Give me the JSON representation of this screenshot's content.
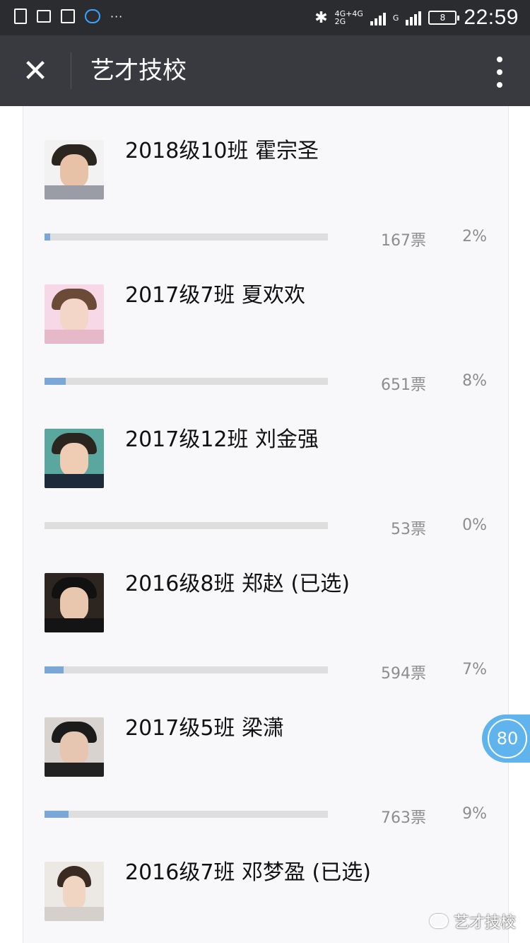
{
  "status_bar": {
    "network_top": "4G+4G",
    "network_bottom": "2G",
    "network_g": "G",
    "battery": "8",
    "time": "22:59"
  },
  "header": {
    "title": "艺才技校",
    "close_icon": "close-icon",
    "more_icon": "more-vertical-icon"
  },
  "candidates": [
    {
      "name": "2018级10班 霍宗圣",
      "votes": "167票",
      "percent": "2%",
      "bar_fraction": 0.02
    },
    {
      "name": "2017级7班 夏欢欢",
      "votes": "651票",
      "percent": "8%",
      "bar_fraction": 0.08
    },
    {
      "name": "2017级12班 刘金强",
      "votes": "53票",
      "percent": "0%",
      "bar_fraction": 0.0
    },
    {
      "name": "2016级8班 郑赵 (已选)",
      "votes": "594票",
      "percent": "7%",
      "bar_fraction": 0.07
    },
    {
      "name": "2017级5班 梁潇",
      "votes": "763票",
      "percent": "9%",
      "bar_fraction": 0.09
    },
    {
      "name": "2016级7班 邓梦盈 (已选)",
      "votes": "",
      "percent": "",
      "bar_fraction": null
    }
  ],
  "float_counter": "80",
  "watermark": "艺才技校",
  "colors": {
    "bar_fill": "#7ba7d6",
    "bar_track": "#dedede",
    "accent": "#5fb4ee"
  }
}
